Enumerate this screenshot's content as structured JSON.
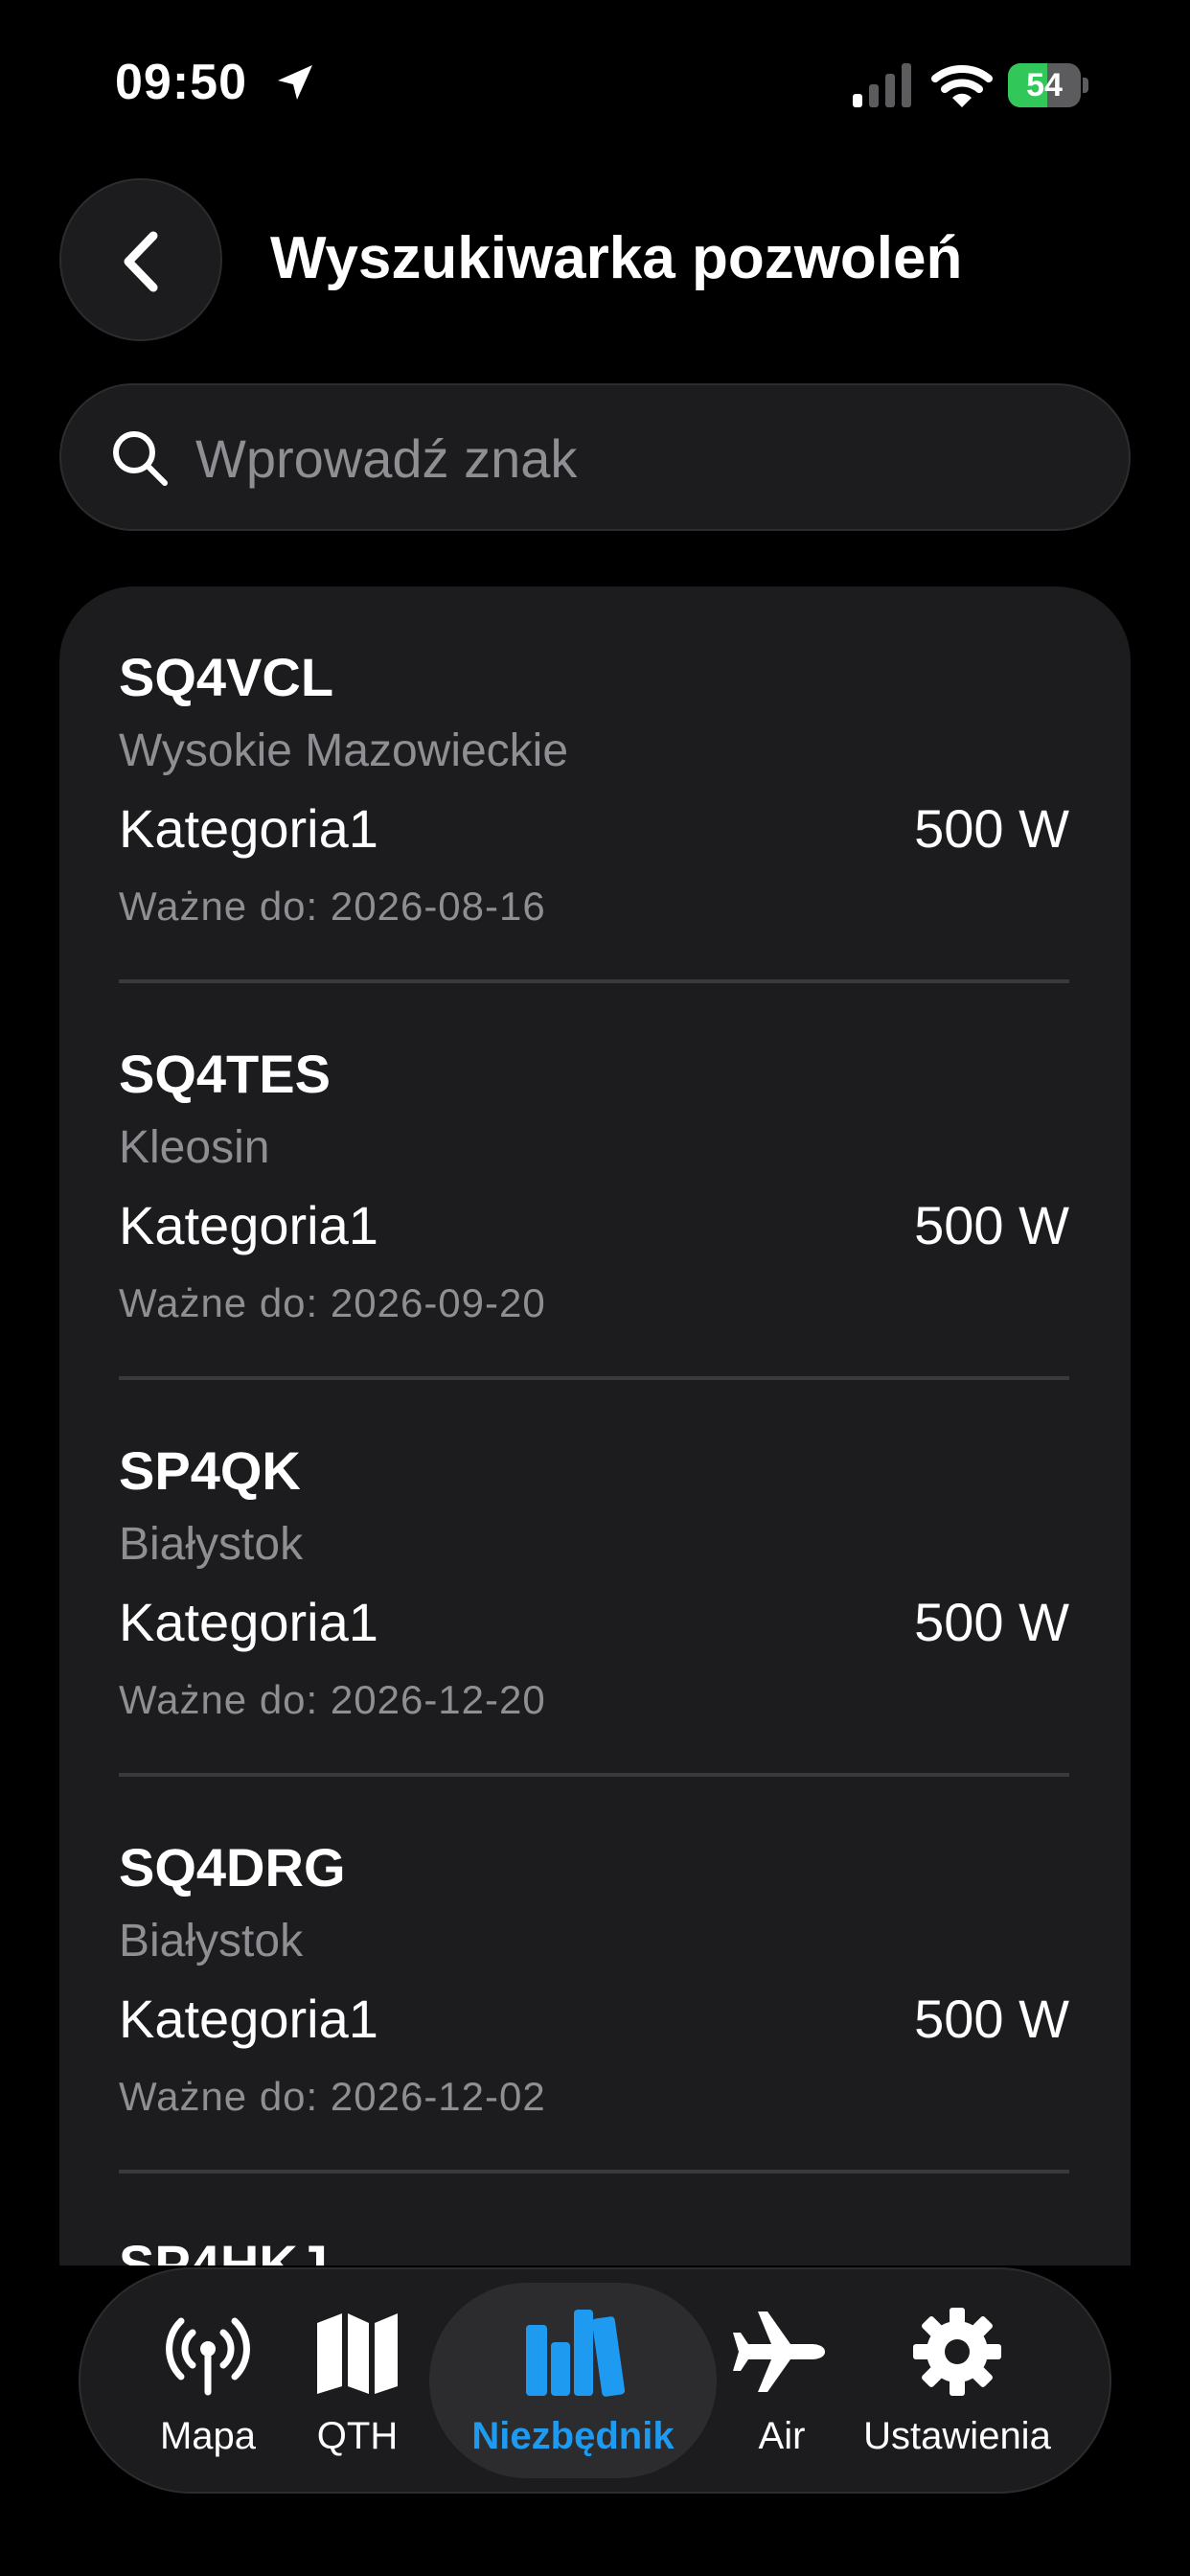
{
  "status_bar": {
    "time": "09:50",
    "battery_level": "54",
    "battery_fraction": 0.54,
    "battery_color": "#31c759"
  },
  "header": {
    "back_icon": "chevron-left-icon",
    "title": "Wyszukiwarka pozwoleń"
  },
  "search": {
    "icon": "search-icon",
    "placeholder": "Wprowadź znak",
    "value": ""
  },
  "results": [
    {
      "callsign": "SQ4VCL",
      "city": "Wysokie Mazowieckie",
      "category": "Kategoria1",
      "power": "500 W",
      "valid": "Ważne do: 2026-08-16"
    },
    {
      "callsign": "SQ4TES",
      "city": "Kleosin",
      "category": "Kategoria1",
      "power": "500 W",
      "valid": "Ważne do: 2026-09-20"
    },
    {
      "callsign": "SP4QK",
      "city": "Białystok",
      "category": "Kategoria1",
      "power": "500 W",
      "valid": "Ważne do: 2026-12-20"
    },
    {
      "callsign": "SQ4DRG",
      "city": "Białystok",
      "category": "Kategoria1",
      "power": "500 W",
      "valid": "Ważne do: 2026-12-02"
    },
    {
      "callsign": "SP4HKJ",
      "city": "",
      "category": "",
      "power": "",
      "valid": ""
    }
  ],
  "tab_bar": {
    "accent_color": "#1e9bf0",
    "tabs": [
      {
        "label": "Mapa",
        "icon": "antenna-icon"
      },
      {
        "label": "QTH",
        "icon": "map-icon"
      },
      {
        "label": "Niezbędnik",
        "icon": "books-icon",
        "selected": true
      },
      {
        "label": "Air",
        "icon": "airplane-icon"
      },
      {
        "label": "Ustawienia",
        "icon": "gear-icon"
      }
    ]
  }
}
